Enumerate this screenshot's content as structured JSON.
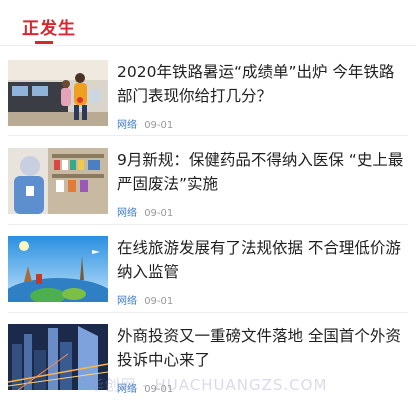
{
  "header": {
    "title": "正发生"
  },
  "articles": [
    {
      "headline": "2020年铁路暑运“成绩单”出炉 今年铁路部门表现你给打几分？",
      "source": "网络",
      "date": "09-01",
      "thumb_icon": "railway-station-photo"
    },
    {
      "headline": "9月新规：保健药品不得纳入医保 “史上最严固废法”实施",
      "source": "网络",
      "date": "09-01",
      "thumb_icon": "pharmacy-photo"
    },
    {
      "headline": "在线旅游发展有了法规依据 不合理低价游纳入监管",
      "source": "网络",
      "date": "09-01",
      "thumb_icon": "travel-globe-photo"
    },
    {
      "headline": "外商投资又一重磅文件落地 全国首个外资投诉中心来了",
      "source": "网络",
      "date": "09-01",
      "thumb_icon": "city-skyline-photo"
    }
  ],
  "watermark": "华创网 - HUACHUANGZS.COM"
}
